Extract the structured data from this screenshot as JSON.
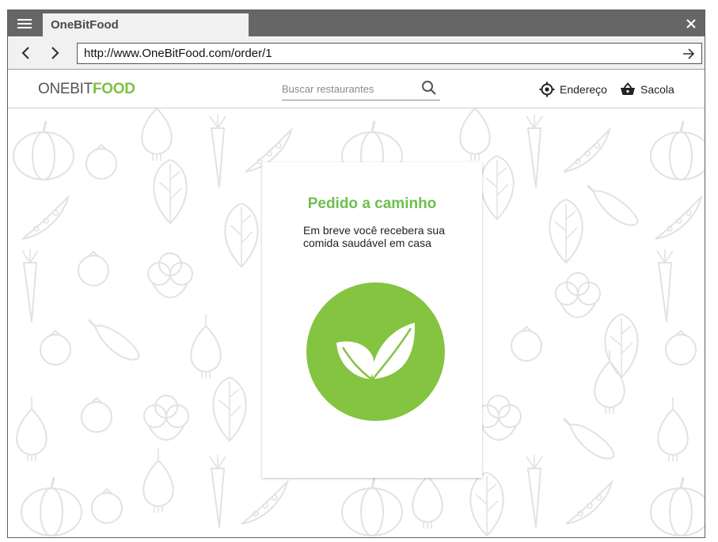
{
  "browser": {
    "tab_title": "OneBitFood",
    "url": "http://www.OneBitFood.com/order/1",
    "icons": {
      "menu": "hamburger-menu-icon",
      "close": "close-icon",
      "back": "chevron-left-icon",
      "forward": "chevron-right-icon",
      "go": "arrow-right-icon"
    }
  },
  "header": {
    "logo_part1": "ONEBIT",
    "logo_part2": "FOOD",
    "search_placeholder": "Buscar restaurantes",
    "search_value": "",
    "address_label": "Endereço",
    "bag_label": "Sacola",
    "icons": {
      "search": "search-icon",
      "address": "location-target-icon",
      "bag": "shopping-basket-icon"
    }
  },
  "order_card": {
    "title": "Pedido a caminho",
    "message": "Em breve você recebera sua comida saudável em casa",
    "icon": "leaf-icon"
  },
  "colors": {
    "brand_green": "#7dc143",
    "title_green": "#6cbf4f",
    "circle_green": "#84c441",
    "titlebar_gray": "#666666"
  }
}
